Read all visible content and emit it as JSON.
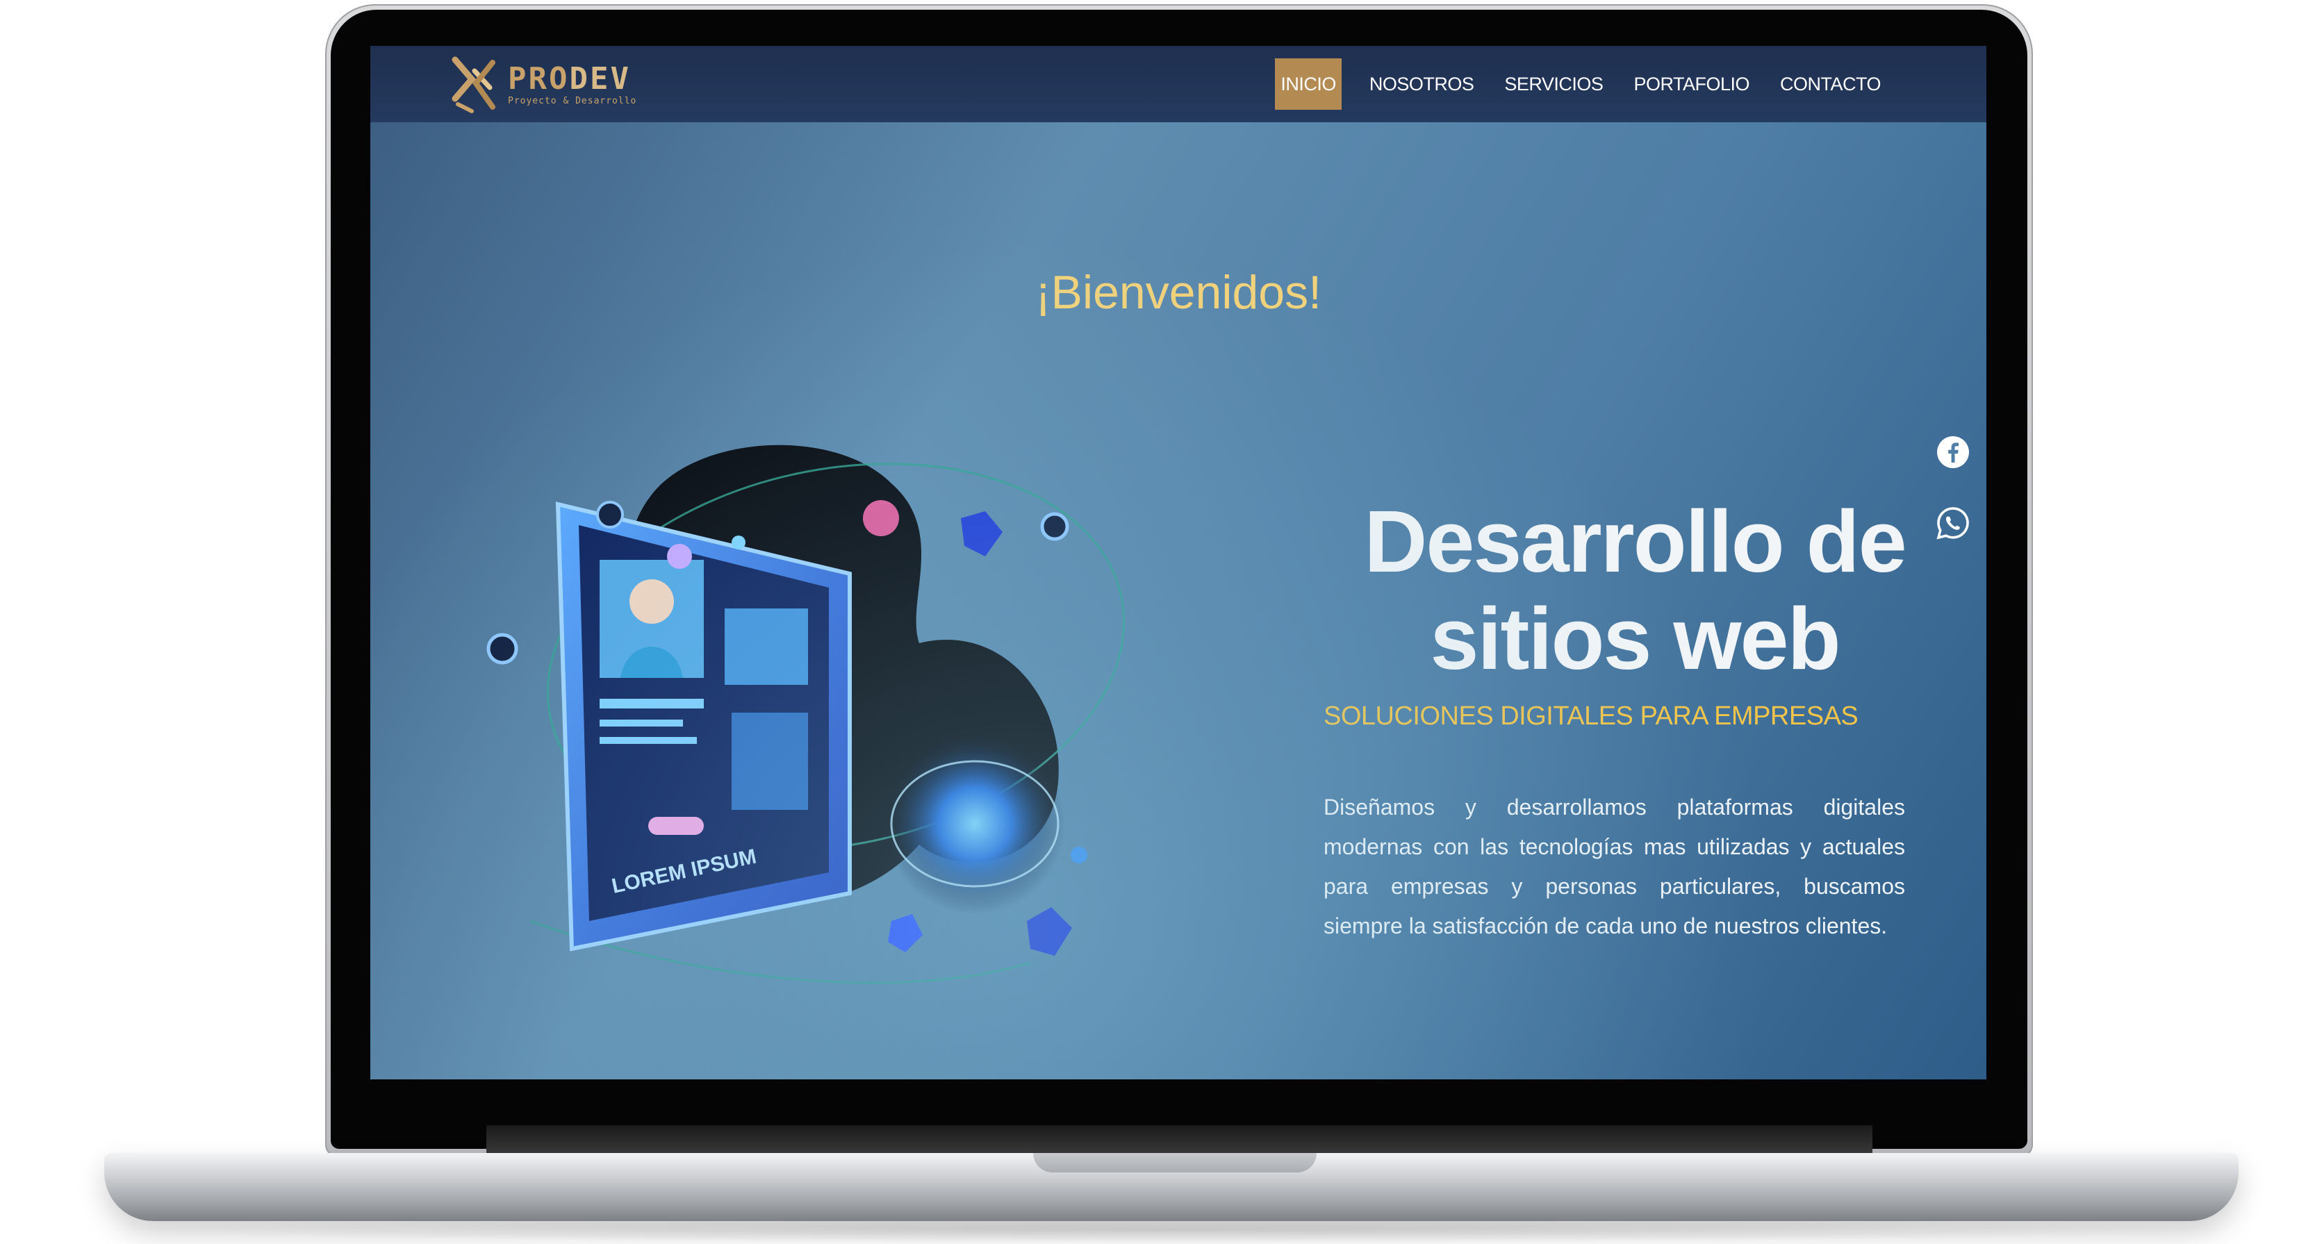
{
  "brand": {
    "name_part1": "PRO",
    "name_part2": "DEV",
    "tagline": "Proyecto & Desarrollo"
  },
  "nav": {
    "items": [
      {
        "label": "INICIO",
        "active": true
      },
      {
        "label": "NOSOTROS"
      },
      {
        "label": "SERVICIOS"
      },
      {
        "label": "PORTAFOLIO"
      },
      {
        "label": "CONTACTO"
      }
    ]
  },
  "hero": {
    "welcome": "¡Bienvenidos!",
    "title": "Desarrollo de sitios web",
    "subtitle": "SOLUCIONES DIGITALES PARA EMPRESAS",
    "description": "Diseñamos y desarrollamos plataformas digitales modernas con las tecnologías mas utilizadas y actuales para empresas y personas particulares, buscamos siempre la satisfacción de cada uno de nuestros clientes."
  },
  "illustration": {
    "screen_text": "LOREM IPSUM"
  },
  "social": {
    "icons": [
      "facebook-icon",
      "whatsapp-icon"
    ]
  },
  "colors": {
    "accent_gold": "#b38a52",
    "welcome_yellow": "#f2d27b",
    "subtitle_yellow": "#f2c54a",
    "navbar_bg": "#1f2f50"
  }
}
